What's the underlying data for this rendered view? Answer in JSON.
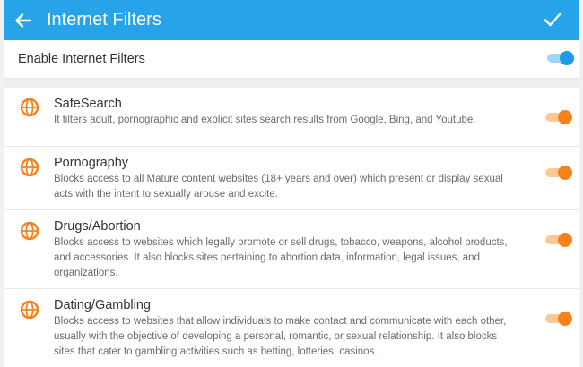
{
  "header": {
    "title": "Internet Filters",
    "back_icon": "arrow-left-icon",
    "confirm_icon": "check-icon",
    "color": "#27a3ea"
  },
  "master_toggle": {
    "label": "Enable Internet Filters",
    "enabled": true,
    "color": "#1e9be6"
  },
  "filters": [
    {
      "title": "SafeSearch",
      "description": "It filters adult, pornographic and explicit sites search results from Google, Bing, and Youtube.",
      "icon": "globe-icon",
      "enabled": true
    },
    {
      "title": "Pornography",
      "description": "Blocks access to all Mature content websites (18+ years and over) which present or display sexual acts with the intent to sexually arouse and excite.",
      "icon": "globe-icon",
      "enabled": true
    },
    {
      "title": "Drugs/Abortion",
      "description": "Blocks access to websites which legally promote or sell drugs, tobacco, weapons, alcohol products, and accessories. It also blocks sites pertaining to abortion data, information, legal issues, and organizations.",
      "icon": "globe-icon",
      "enabled": true
    },
    {
      "title": "Dating/Gambling",
      "description": "Blocks access to websites that allow individuals to make contact and communicate with each other, usually with the objective of developing a personal, romantic, or sexual relationship. It also blocks sites that cater to gambling activities such as betting, lotteries, casinos.",
      "icon": "globe-icon",
      "enabled": true
    }
  ],
  "colors": {
    "filter_accent": "#f7821b"
  }
}
